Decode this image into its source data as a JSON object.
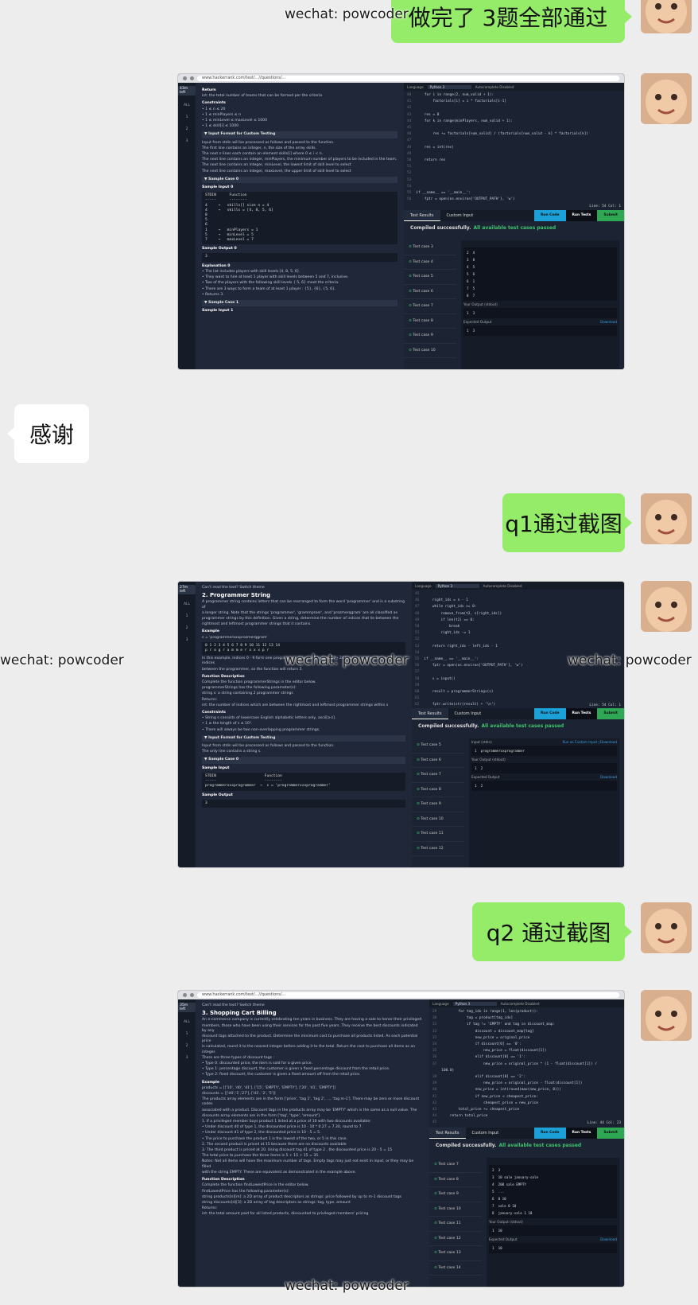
{
  "watermark": "wechat: powcoder",
  "messages": {
    "m1": "做完了 3题全部通过",
    "m2": "感谢",
    "m3": "q1通过截图",
    "m4": "q2 通过截图"
  },
  "shot1": {
    "url": "www.hackerrank.com/test/...//questions/...",
    "timer": "43m left",
    "rail": [
      "ALL",
      "1",
      "2",
      "3"
    ],
    "problem": [
      {
        "k": "b",
        "t": "Return"
      },
      {
        "k": "l",
        "t": "int: the total number of teams that can be formed per the criteria"
      },
      {
        "k": "b",
        "t": "Constraints"
      },
      {
        "k": "l",
        "t": "• 1 ≤ n ≤ 20"
      },
      {
        "k": "l",
        "t": "• 1 ≤ minPlayers ≤ n"
      },
      {
        "k": "l",
        "t": "• 1 ≤ minLevel ≤ maxLevel ≤ 1000"
      },
      {
        "k": "l",
        "t": "• 1 ≤ skill[i] ≤ 1000"
      },
      {
        "k": "s",
        "t": "▼ Input Format for Custom Testing"
      },
      {
        "k": "l",
        "t": "Input from stdin will be processed as follows and passed to the function."
      },
      {
        "k": "l",
        "t": "The first line contains an integer, n, the size of the array skills."
      },
      {
        "k": "l",
        "t": "The next n lines each contain an element skills[i] where 0 ≤ i < n."
      },
      {
        "k": "l",
        "t": "The next line contains an integer, minPlayers, the minimum number of players to be included in the team."
      },
      {
        "k": "l",
        "t": "The next line contains an integer, minLevel, the lowest limit of skill level to select"
      },
      {
        "k": "l",
        "t": "The next line contains an integer, maxLevel, the upper limit of skill level to select"
      },
      {
        "k": "s",
        "t": "▼ Sample Case 0"
      },
      {
        "k": "b",
        "t": "Sample Input 0"
      },
      {
        "k": "x",
        "t": "STDIN      Function\n-----      --------\n4     →   skills[] size n = 4\n4     →   skills = [4, 8, 5, 6]\n8\n5\n6\n1     →   minPlayers = 1\n5     →   minLevel = 5\n7     →   maxLevel = 7"
      },
      {
        "k": "b",
        "t": "Sample Output 0"
      },
      {
        "k": "x",
        "t": "3"
      },
      {
        "k": "b",
        "t": "Explanation 0"
      },
      {
        "k": "l",
        "t": "• The list includes players with skill levels [4, 8, 5, 6]."
      },
      {
        "k": "l",
        "t": "• They want to hire at least 1 player with skill levels between 5 and 7, inclusive."
      },
      {
        "k": "l",
        "t": "• Two of the players with the following skill levels { 5, 6} meet the criteria."
      },
      {
        "k": "l",
        "t": "• There are 3 ways to form a team of at least 1 player : {5}, {6}, {5, 6}."
      },
      {
        "k": "l",
        "t": "• Returns 3."
      },
      {
        "k": "s",
        "t": "▼ Sample Case 1"
      },
      {
        "k": "b",
        "t": "Sample Input 1"
      }
    ],
    "bar": {
      "language": "Language",
      "lang": "Python 3",
      "auto": "Autocomplete Disabled"
    },
    "code": [
      [
        "40",
        "    for i in range(2, num_valid + 1):"
      ],
      [
        "41",
        "        factorials[i] = i * factorials[i-1]"
      ],
      [
        "42",
        ""
      ],
      [
        "43",
        "    res = 0"
      ],
      [
        "44",
        "    for k in range(minPlayers, num_valid + 1):"
      ],
      [
        "45",
        ""
      ],
      [
        "46",
        "        res += factorials[num_valid] / (factorials[num_valid - k] * factorials[k])"
      ],
      [
        "47",
        ""
      ],
      [
        "48",
        "    res = int(res)"
      ],
      [
        "49",
        ""
      ],
      [
        "50",
        "    return res"
      ],
      [
        "51",
        ""
      ],
      [
        "52",
        ""
      ],
      [
        "53",
        ""
      ],
      [
        "54",
        ""
      ],
      [
        "55",
        "if __name__ == '__main__':"
      ],
      [
        "56",
        "    fptr = open(os.environ['OUTPUT_PATH'], 'w')"
      ]
    ],
    "status": "Line: 54 Col: 1",
    "tabs": [
      "Test Results",
      "Custom Input"
    ],
    "buttons": [
      "Run Code",
      "Run Tests",
      "Submit"
    ],
    "compiled": "Compiled successfully.",
    "passed": "All available test cases passed",
    "tests": [
      "Test case 3",
      "Test case 4",
      "Test case 5",
      "Test case 6",
      "Test case 7",
      "Test case 8",
      "Test case 9",
      "Test case 10"
    ],
    "detail": [
      {
        "label": "",
        "link": "",
        "value": "2  4\n3  8\n4  5\n5  6\n6  1\n7  5\n8  7"
      },
      {
        "label": "Your Output (stdout)",
        "link": "",
        "value": "1  3"
      },
      {
        "label": "Expected Output",
        "link": "Download",
        "value": "1  3"
      }
    ]
  },
  "shot2": {
    "timer": "27m left",
    "rail": [
      "ALL",
      "1",
      "2",
      "3"
    ],
    "problem": [
      {
        "k": "g",
        "t": "Can't read the text? Switch theme"
      },
      {
        "k": "h",
        "t": "2. Programmer String"
      },
      {
        "k": "l",
        "t": "A programmer string contains letters that can be rearranged to form the word 'programmer' and is a substring of"
      },
      {
        "k": "l",
        "t": "a longer string. Note that the strings 'programmer', 'grammproer', and 'prozmerqgram' are all classified as"
      },
      {
        "k": "l",
        "t": "programmer strings by this definition. Given a string, determine the number of indices that lie between the"
      },
      {
        "k": "l",
        "t": "rightmost and leftmost programmer strings that it contains."
      },
      {
        "k": "b",
        "t": "Example"
      },
      {
        "k": "l",
        "t": "s = 'programmerxxxprozmerqgram'"
      },
      {
        "k": "x",
        "t": "0 1 2 3 4 5 6 7 8 9 10 11 12 13 14\np r o g r a m m e r x x x p r"
      },
      {
        "k": "l",
        "t": "In this example, indices 0 - 9 form one programmer string and indices 13 - 24 contain another. There are 3 indices"
      },
      {
        "k": "l",
        "t": "between the programmer, so the function will return 3."
      },
      {
        "k": "b",
        "t": "Function Description"
      },
      {
        "k": "l",
        "t": "Complete the function programmerStrings in the editor below."
      },
      {
        "k": "l",
        "t": "programmerStrings has the following parameter(s):"
      },
      {
        "k": "l",
        "t": "    string s:  a string containing 2 programmer strings"
      },
      {
        "k": "l",
        "t": "Returns:"
      },
      {
        "k": "l",
        "t": "    int: the number of indices which are between the rightmost and leftmost programmer strings within s"
      },
      {
        "k": "b",
        "t": "Constraints"
      },
      {
        "k": "l",
        "t": "• String s consists of lowercase English alphabetic letters only, ascii[a-z]."
      },
      {
        "k": "l",
        "t": "• 1 ≤ the length of s ≤ 10⁵."
      },
      {
        "k": "l",
        "t": "• There will always be two non-overlapping programmer strings."
      },
      {
        "k": "s",
        "t": "▼ Input Format for Custom Testing"
      },
      {
        "k": "l",
        "t": "Input from stdin will be processed as follows and passed to the function."
      },
      {
        "k": "l",
        "t": "The only line contains a string s."
      },
      {
        "k": "s",
        "t": "▼ Sample Case 0"
      },
      {
        "k": "b",
        "t": "Sample Input"
      },
      {
        "k": "x",
        "t": "STDIN                      Function\n-----                      --------\nprogrammerxxxprogrammer  →  s = 'programmerxxxprogrammer'"
      },
      {
        "k": "b",
        "t": "Sample Output"
      },
      {
        "k": "x",
        "t": "3"
      }
    ],
    "bar": {
      "language": "Language",
      "lang": "Python 3",
      "auto": "Autocomplete Disabled"
    },
    "code": [
      [
        "45",
        ""
      ],
      [
        "46",
        "    right_ids = n - 1"
      ],
      [
        "47",
        "    while right_ids >= 0:"
      ],
      [
        "48",
        "        remove_from(t2, s[right_ids])"
      ],
      [
        "49",
        "        if len(t2) == 0:"
      ],
      [
        "50",
        "            break"
      ],
      [
        "51",
        "        right_ids -= 1"
      ],
      [
        "52",
        ""
      ],
      [
        "53",
        "    return right_ids - left_ids - 1"
      ],
      [
        "54",
        ""
      ],
      [
        "55",
        "if __name__ == '__main__':"
      ],
      [
        "56",
        "    fptr = open(os.environ['OUTPUT_PATH'], 'w')"
      ],
      [
        "57",
        ""
      ],
      [
        "58",
        "    s = input()"
      ],
      [
        "59",
        ""
      ],
      [
        "60",
        "    result = programmerStrings(s)"
      ],
      [
        "61",
        ""
      ],
      [
        "62",
        "    fptr.write(str(result) + '\\n')"
      ]
    ],
    "status": "Line: 54 Col: 1",
    "tabs": [
      "Test Results",
      "Custom Input"
    ],
    "buttons": [
      "Run Code",
      "Run Tests",
      "Submit"
    ],
    "compiled": "Compiled successfully.",
    "passed": "All available test cases passed",
    "tests": [
      "Test case 5",
      "Test case 6",
      "Test case 7",
      "Test case 8",
      "Test case 9",
      "Test case 10",
      "Test case 11",
      "Test case 12"
    ],
    "detail": [
      {
        "label": "Input (stdin)",
        "link": "Run as Custom Input | Download",
        "value": "1  programmerxxprogrammer"
      },
      {
        "label": "Your Output (stdout)",
        "link": "",
        "value": "1  2"
      },
      {
        "label": "Expected Output",
        "link": "Download",
        "value": "1  2"
      }
    ]
  },
  "shot3": {
    "url": "www.hackerrank.com/test/...//questions/...",
    "timer": "35m left",
    "rail": [
      "ALL",
      "1",
      "2",
      "3"
    ],
    "problem": [
      {
        "k": "g",
        "t": "Can't read the text? Switch theme"
      },
      {
        "k": "h",
        "t": "3. Shopping Cart Billing"
      },
      {
        "k": "l",
        "t": "An e-commerce company is currently celebrating ten years in business. They are having a sale to honor their privileged"
      },
      {
        "k": "l",
        "t": "members, those who have been using their services for the past five years. They receive the best discounts indicated by any"
      },
      {
        "k": "l",
        "t": "discount tags attached to the product. Determine the minimum cost to purchase all products listed. As each potential price"
      },
      {
        "k": "l",
        "t": "is calculated, round it to the nearest integer before adding it to the total. Return the cost to purchase all items as an integer."
      },
      {
        "k": "l",
        "t": "There are three types of discount tags :"
      },
      {
        "k": "l",
        "t": "• Type 0: discounted price, the item is sold for a given price."
      },
      {
        "k": "l",
        "t": "• Type 1: percentage discount, the customer is given a fixed percentage discount from the retail price."
      },
      {
        "k": "l",
        "t": "• Type 2: fixed discount, the customer is given a fixed amount off from the retail price."
      },
      {
        "k": "b",
        "t": "Example"
      },
      {
        "k": "l",
        "t": "products = [['10', 'd0', 'd1'], ['15', 'EMPTY', 'EMPTY'], ['20', 'd1', 'EMPTY']]"
      },
      {
        "k": "l",
        "t": "discounts = [['d0','1','27'], ['d1', '2', '5']]"
      },
      {
        "k": "l",
        "t": "The products array elements are in the form ['price', 'tag 1', 'tag 2', ..., 'tag m-1']. There may be zero or more discount codes"
      },
      {
        "k": "l",
        "t": "associated with a product. Discount tags in the products array may be 'EMPTY' which is the same as a null value. The"
      },
      {
        "k": "l",
        "t": "discounts array elements are in the form ['tag', 'type', 'amount']."
      },
      {
        "k": "l",
        "t": "1. If a privileged member buys product 1 listed at a price of 10 with two discounts available:"
      },
      {
        "k": "l",
        "t": "     • Under discount d0 of type 1, the discounted price is 10 - 10 * 0.27 = 7.30, round to 7."
      },
      {
        "k": "l",
        "t": "     • Under discount d1 of type 2, the discounted price is 10 - 5 = 5."
      },
      {
        "k": "l",
        "t": "     • The price to purchase the product 1 is the lowest of the two, or 5 in this case."
      },
      {
        "k": "l",
        "t": "2. The second product is priced at 15 because there are no discounts available"
      },
      {
        "k": "l",
        "t": "3. The third product is priced at 20. Using discount tag d1 of type 2 , the discounted price is 20 - 5 = 15"
      },
      {
        "k": "l",
        "t": "The total price to purchase the three items is 5 + 15 + 15 = 35."
      },
      {
        "k": "l",
        "t": "Notes: Not all items will have the maximum number of tags. Empty tags may just not exist in input, or they may be filled"
      },
      {
        "k": "l",
        "t": "with the string EMPTY. These are equivalent as demonstrated in the example above."
      },
      {
        "k": "b",
        "t": "Function Description"
      },
      {
        "k": "l",
        "t": "Complete the function findLowestPrice in the editor below."
      },
      {
        "k": "l",
        "t": "findLowestPrice has the following parameter(s):"
      },
      {
        "k": "l",
        "t": "    string products[n][m]: a 2D array of product descriptors as strings: price followed by up to m-1 discount tags"
      },
      {
        "k": "l",
        "t": "    string discounts[d][3]: a 2D array of tag descriptors as strings: tag, type, amount"
      },
      {
        "k": "l",
        "t": "Returns:"
      },
      {
        "k": "l",
        "t": "    int: the total amount paid for all listed products, discounted to privileged members' pricing"
      }
    ],
    "bar": {
      "language": "Language",
      "lang": "Python 3",
      "auto": "Autocomplete Disabled"
    },
    "code": [
      [
        "29",
        "        for tag_idx in range(1, len(product)):"
      ],
      [
        "30",
        "            tag = product[tag_idx]"
      ],
      [
        "31",
        "            if tag != 'EMPTY' and tag in discount_map:"
      ],
      [
        "32",
        "                discount = discount_map[tag]"
      ],
      [
        "33",
        "                new_price = original_price"
      ],
      [
        "34",
        "                if discount[0] == '0':"
      ],
      [
        "35",
        "                    new_price = float(discount[1])"
      ],
      [
        "36",
        "                elif discount[0] == '1':"
      ],
      [
        "37",
        "                    new_price = original_price * (1 - float(discount[1]) /"
      ],
      [
        "  ",
        "100.0)"
      ],
      [
        "38",
        "                elif discount[0] == '2':"
      ],
      [
        "39",
        "                    new_price = original_price - float(discount[1])"
      ],
      [
        "40",
        "                new_price = int(round(max(new_price, 0)))"
      ],
      [
        "41",
        "                if new_price < cheapest_price:"
      ],
      [
        "42",
        "                    cheapest_price = new_price"
      ],
      [
        "43",
        "        total_price += cheapest_price"
      ],
      [
        "44",
        "    return total_price"
      ],
      [
        "45",
        ""
      ],
      [
        "46",
        "if __name__ == '__main__':"
      ]
    ],
    "status": "Line: 44 Col: 23",
    "tabs": [
      "Test Results",
      "Custom Input"
    ],
    "buttons": [
      "Run Code",
      "Run Tests",
      "Submit"
    ],
    "compiled": "Compiled successfully.",
    "passed": "All available test cases passed",
    "tests": [
      "Test case 7",
      "Test case 8",
      "Test case 9",
      "Test case 10",
      "Test case 11",
      "Test case 12",
      "Test case 13",
      "Test case 14"
    ],
    "detail": [
      {
        "label": "",
        "link": "",
        "value": "2  3\n3  10 sale january-sale\n4  200 sale EMPTY\n5  ...\n6  0 10\n7  sale 0 10\n8  january-sale 1 10"
      },
      {
        "label": "Your Output (stdout)",
        "link": "",
        "value": "1  10"
      },
      {
        "label": "Expected Output",
        "link": "Download",
        "value": "1  10"
      }
    ]
  }
}
